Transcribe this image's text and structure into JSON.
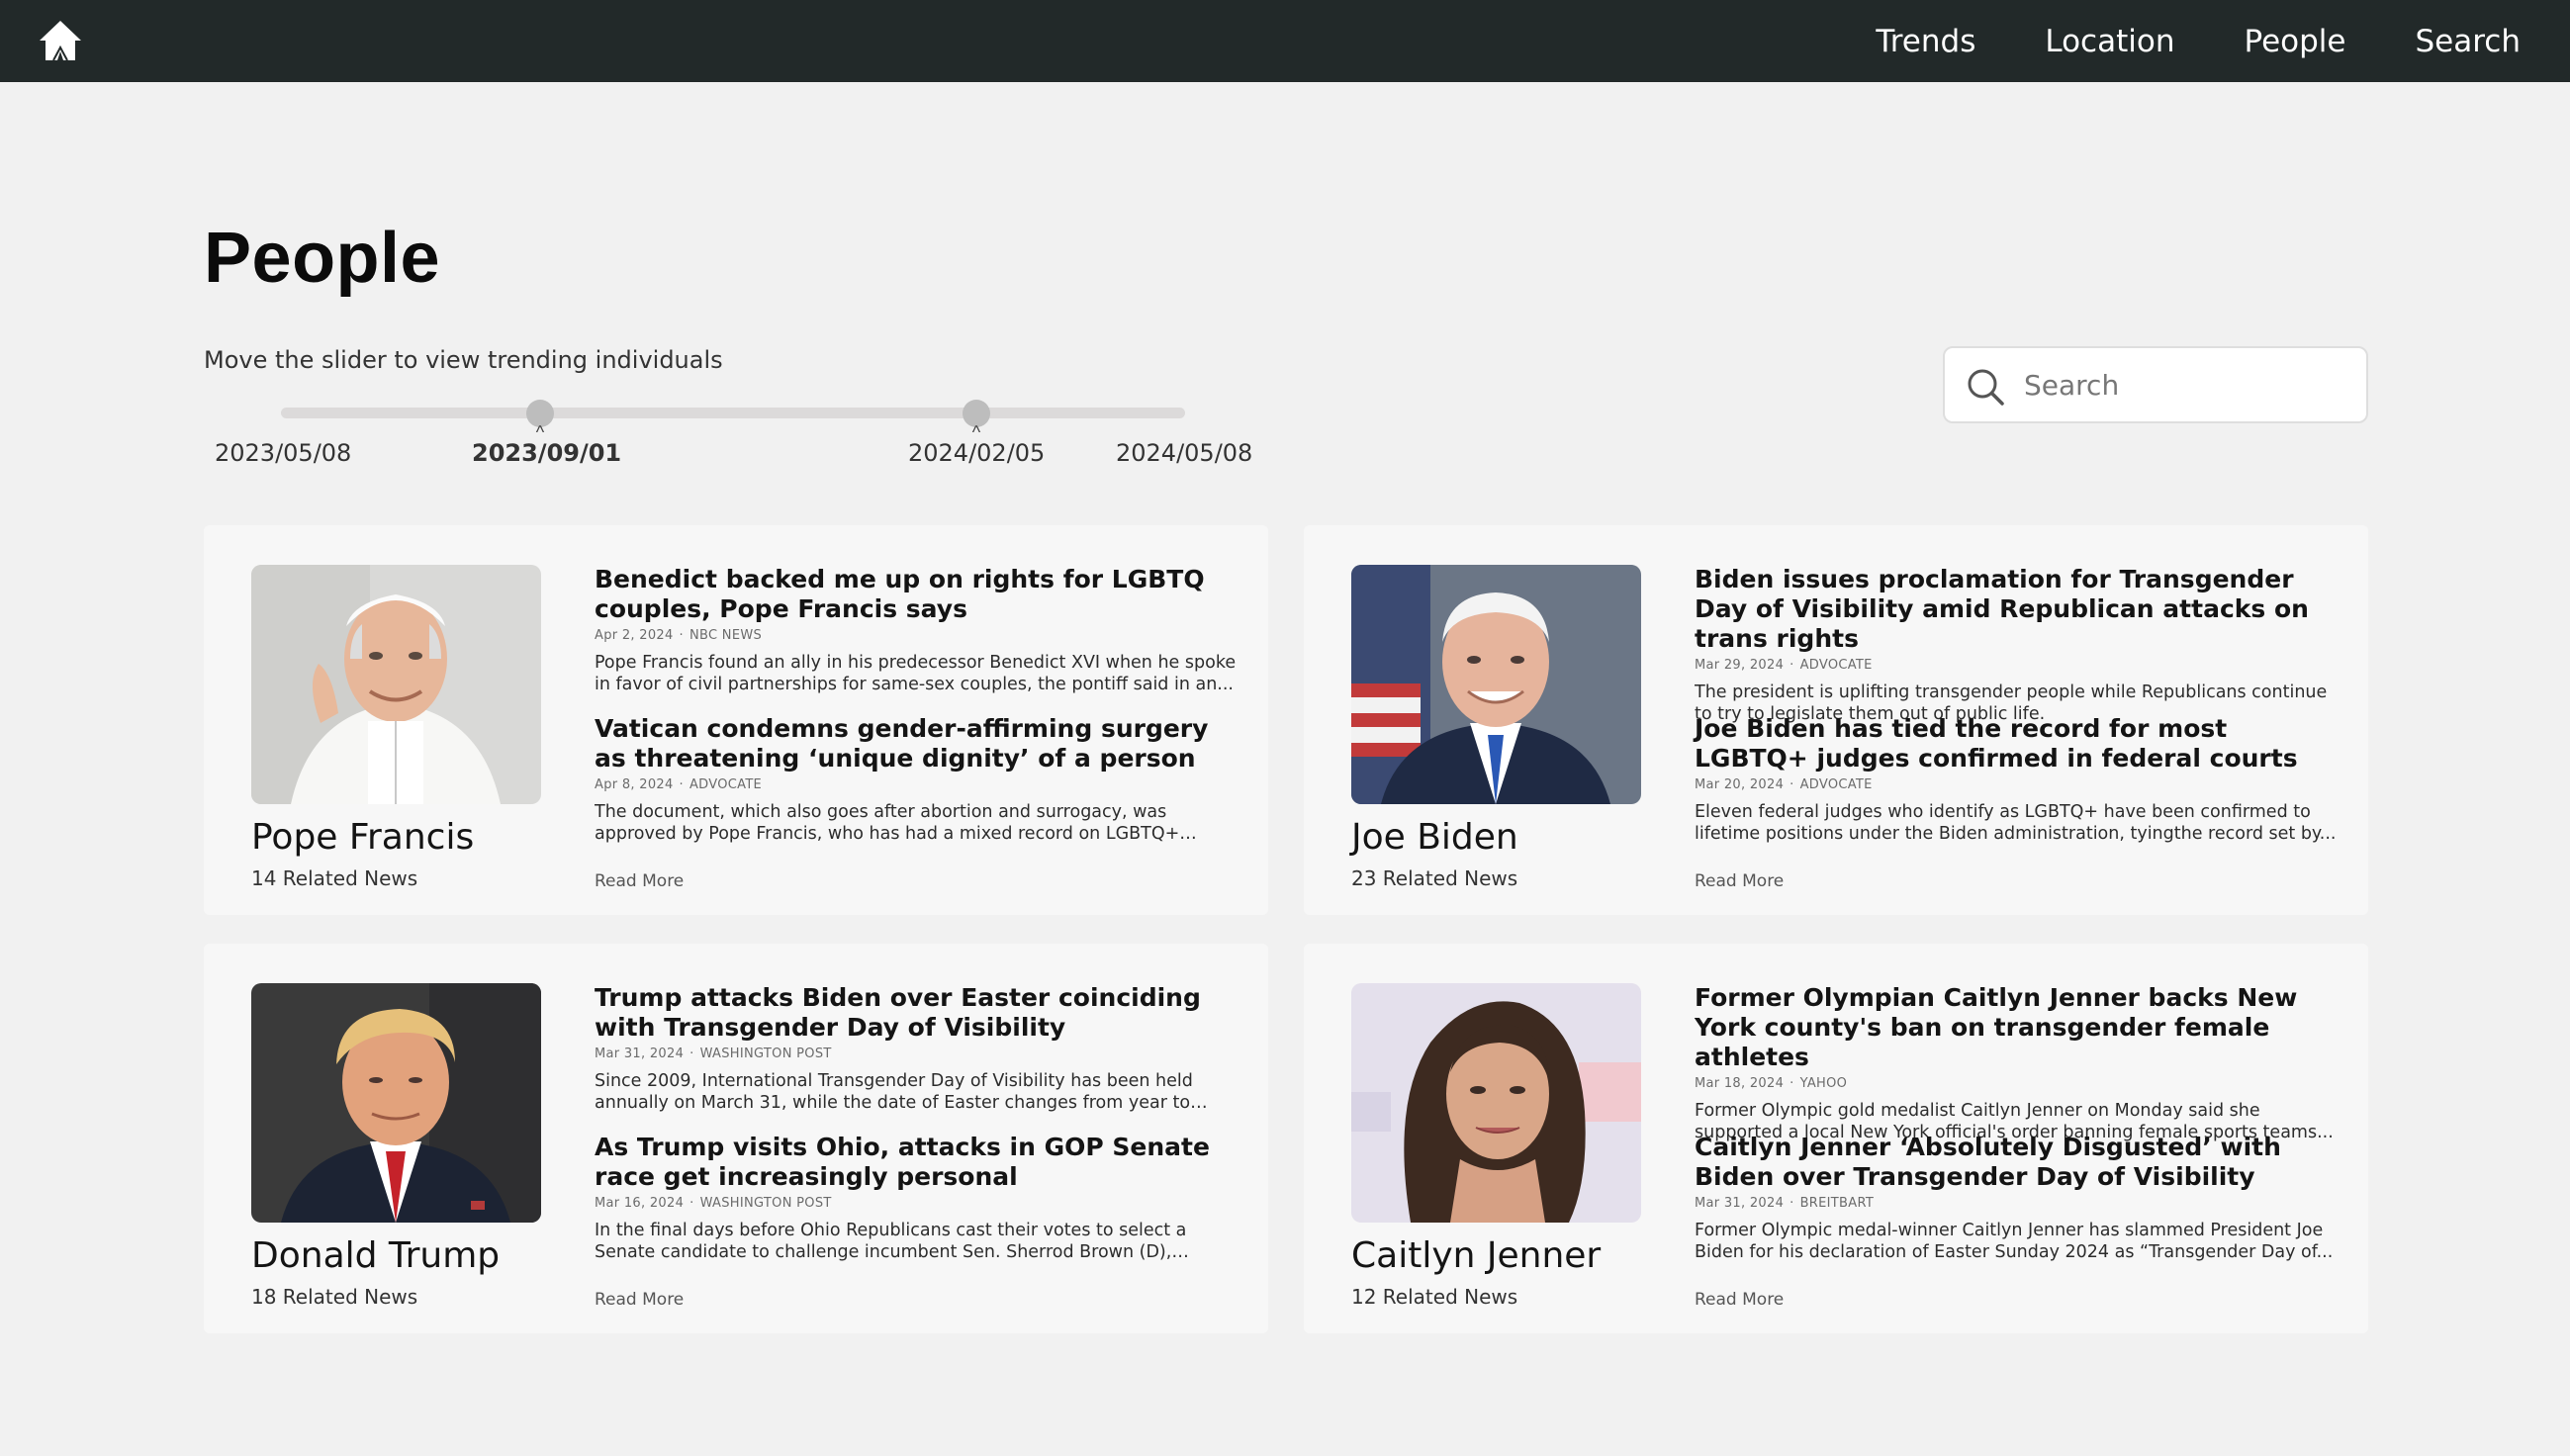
{
  "nav": {
    "home_icon": "home-icon",
    "links": [
      "Trends",
      "Location",
      "People",
      "Search"
    ]
  },
  "page": {
    "title": "People",
    "slider_hint": "Move the slider to view trending individuals"
  },
  "slider": {
    "ticks": [
      "2023/05/08",
      "2023/09/01",
      "2024/02/05",
      "2024/05/08"
    ],
    "selected_start": "2023/09/01",
    "selected_end": "2024/02/05"
  },
  "search": {
    "placeholder": "Search",
    "icon": "search-icon"
  },
  "colors": {
    "topbar": "#222929",
    "background": "#f1f1f1",
    "card": "#f7f7f7"
  },
  "people": [
    {
      "name": "Pope Francis",
      "related": "14 Related News",
      "read_more": "Read More",
      "news": [
        {
          "title": "Benedict backed me up on rights for LGBTQ couples, Pope Francis says",
          "date": "Apr 2, 2024",
          "source": "NBC NEWS",
          "desc": "Pope Francis found an ally in his predecessor Benedict XVI when he spoke in favor of civil partnerships for same-sex couples, the pontiff said in an..."
        },
        {
          "title": "Vatican condemns gender-affirming surgery as threatening ‘unique dignity’ of a person",
          "date": "Apr 8, 2024",
          "source": "ADVOCATE",
          "desc": "The document, which also goes after abortion and surrogacy, was approved by Pope Francis, who has had a mixed record on LGBTQ+ right..."
        }
      ]
    },
    {
      "name": "Joe Biden",
      "related": "23 Related News",
      "read_more": "Read More",
      "news": [
        {
          "title": "Biden issues proclamation for Transgender Day of Visibility amid Republican attacks on trans rights",
          "date": "Mar 29, 2024",
          "source": "ADVOCATE",
          "desc": "The president is uplifting transgender people while Republicans continue to try to legislate them out of public life."
        },
        {
          "title": "Joe Biden has tied the record for most LGBTQ+ judges confirmed in federal courts",
          "date": "Mar 20, 2024",
          "source": "ADVOCATE",
          "desc": "Eleven federal judges who identify as LGBTQ+ have been confirmed to lifetime positions under the Biden administration, tyingthe record set by..."
        }
      ]
    },
    {
      "name": "Donald Trump",
      "related": "18 Related News",
      "read_more": "Read More",
      "news": [
        {
          "title": "Trump attacks Biden over Easter coinciding with Transgender Day of Visibility",
          "date": "Mar 31, 2024",
          "source": "WASHINGTON POST",
          "desc": "Since 2009, International Transgender Day of Visibility has been held annually on March 31, while the date of Easter changes from year to year."
        },
        {
          "title": "As Trump visits Ohio, attacks in GOP Senate race get increasingly personal",
          "date": "Mar 16, 2024",
          "source": "WASHINGTON POST",
          "desc": "In the final days before Ohio Republicans cast their votes to select a Senate candidate to challenge incumbent Sen. Sherrod Brown (D), politic..."
        }
      ]
    },
    {
      "name": "Caitlyn Jenner",
      "related": "12 Related News",
      "read_more": "Read More",
      "news": [
        {
          "title": "Former Olympian Caitlyn Jenner backs New York county's ban on transgender female athletes",
          "date": "Mar 18, 2024",
          "source": "YAHOO",
          "desc": "Former Olympic gold medalist Caitlyn Jenner on Monday said she supported a local New York official's order banning female sports teams..."
        },
        {
          "title": "Caitlyn Jenner ‘Absolutely Disgusted’ with Biden over Transgender Day of Visibility",
          "date": "Mar 31, 2024",
          "source": "BREITBART",
          "desc": "Former Olympic medal-winner Caitlyn Jenner has slammed President Joe Biden for his declaration of Easter Sunday 2024 as “Transgender Day of..."
        }
      ]
    }
  ]
}
